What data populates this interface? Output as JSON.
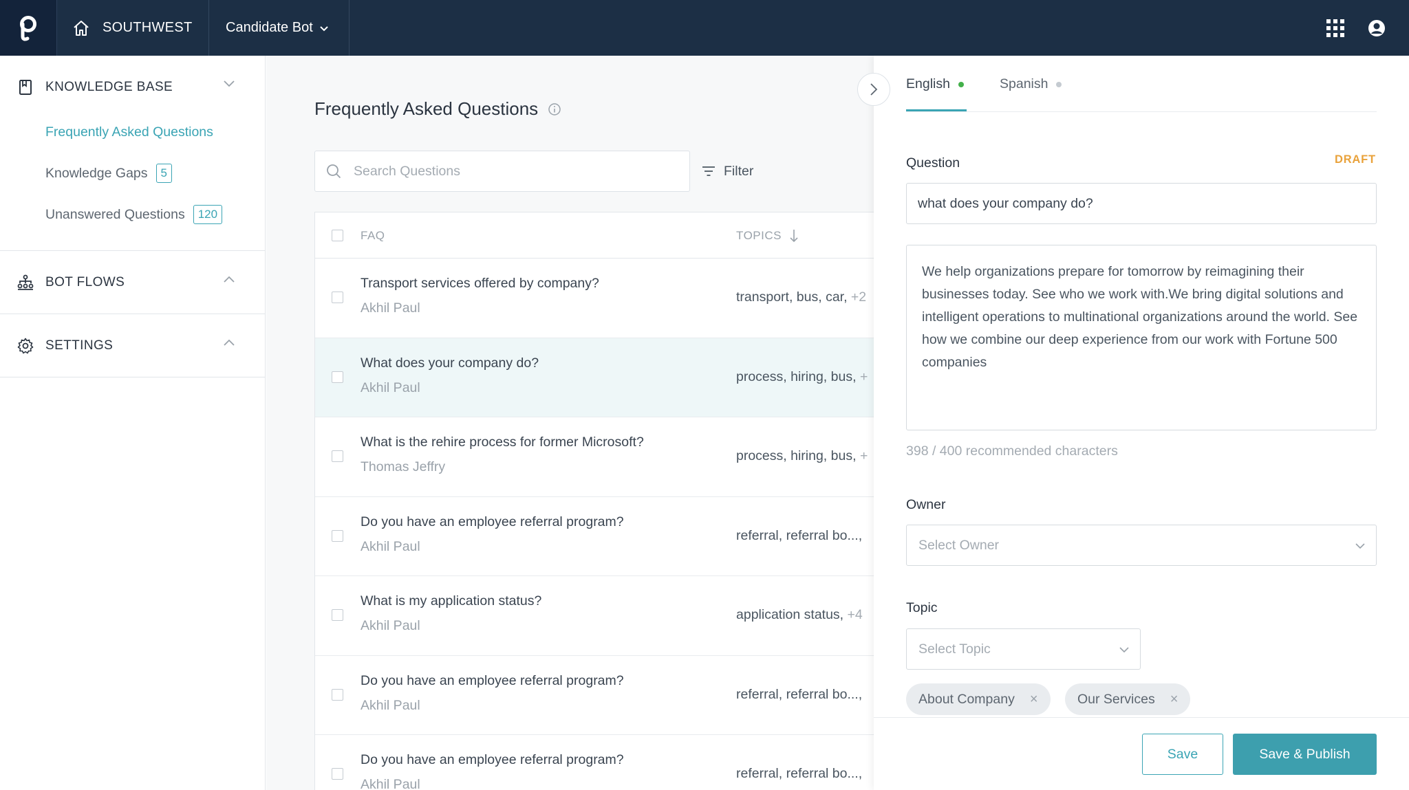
{
  "topbar": {
    "org_name": "SOUTHWEST",
    "bot_name": "Candidate Bot"
  },
  "sidebar": {
    "knowledge_base": {
      "label": "KNOWLEDGE BASE",
      "items": [
        {
          "label": "Frequently Asked Questions",
          "badge": ""
        },
        {
          "label": "Knowledge Gaps",
          "badge": "5"
        },
        {
          "label": "Unanswered Questions",
          "badge": "120"
        }
      ]
    },
    "bot_flows": {
      "label": "BOT FLOWS"
    },
    "settings": {
      "label": "SETTINGS"
    }
  },
  "main": {
    "title": "Frequently Asked Questions",
    "search_placeholder": "Search Questions",
    "filter_label": "Filter",
    "columns": {
      "faq": "FAQ",
      "topics": "TOPICS"
    },
    "rows": [
      {
        "question": "Transport services offered by company?",
        "author": "Akhil Paul",
        "topics": "transport, bus, car,",
        "more": "+2"
      },
      {
        "question": "What does your company do?",
        "author": "Akhil Paul",
        "topics": "process, hiring, bus,",
        "more": "+"
      },
      {
        "question": "What is the rehire process for former Microsoft?",
        "author": "Thomas Jeffry",
        "topics": "process, hiring, bus,",
        "more": "+"
      },
      {
        "question": "Do you have an employee referral program?",
        "author": "Akhil Paul",
        "topics": "referral, referral bo...,",
        "more": ""
      },
      {
        "question": "What is my application status?",
        "author": "Akhil Paul",
        "topics": "application status,",
        "more": "+4"
      },
      {
        "question": "Do you have an employee referral program?",
        "author": "Akhil Paul",
        "topics": "referral, referral bo...,",
        "more": ""
      },
      {
        "question": "Do you have an employee referral program?",
        "author": "Akhil Paul",
        "topics": "referral, referral bo...,",
        "more": ""
      }
    ]
  },
  "panel": {
    "tabs": {
      "english": "English",
      "spanish": "Spanish"
    },
    "question_label": "Question",
    "status": "DRAFT",
    "question_value": "what does your company do?",
    "answer": "We help organizations prepare for tomorrow by reimagining their businesses today. See who we work with.We bring digital solutions and intelligent operations to multinational organizations around the world. See how we combine our deep experience from our work with Fortune 500 companies",
    "char_count": "398 / 400 recommended characters",
    "owner_label": "Owner",
    "owner_placeholder": "Select Owner",
    "topic_label": "Topic",
    "topic_placeholder": "Select Topic",
    "topic_chips": [
      "About Company",
      "Our Services"
    ],
    "save_label": "Save",
    "publish_label": "Save & Publish"
  },
  "colors": {
    "topbar": "#1c2f45",
    "accent": "#3aa4b4",
    "draft": "#e9a23b",
    "english_dot": "#43b04a"
  }
}
